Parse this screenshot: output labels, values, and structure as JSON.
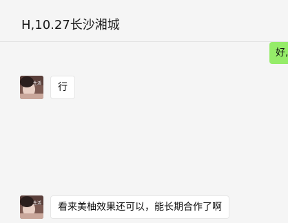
{
  "header": {
    "title": "H,10.27长沙湘城"
  },
  "messages": [
    {
      "direction": "outgoing",
      "text": "好,"
    },
    {
      "direction": "incoming",
      "avatar_badge": "生活",
      "text": "行"
    },
    {
      "direction": "incoming",
      "avatar_badge": "生活",
      "text": "看来美柚效果还可以，能长期合作了啊"
    }
  ],
  "colors": {
    "outgoing_bubble": "#95ec69",
    "incoming_bubble": "#ffffff",
    "background": "#f5f5f5"
  }
}
